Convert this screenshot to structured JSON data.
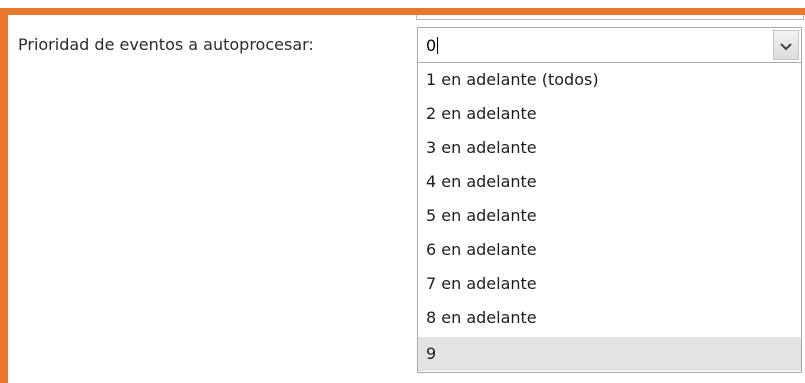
{
  "form": {
    "label": "Prioridad de eventos a autoprocesar:",
    "select": {
      "value": "0",
      "options": [
        "1 en adelante (todos)",
        "2 en adelante",
        "3 en adelante",
        "4 en adelante",
        "5 en adelante",
        "6 en adelante",
        "7 en adelante",
        "8 en adelante",
        "9"
      ],
      "highlighted_option": "9"
    }
  },
  "colors": {
    "frame_border": "#e8782e",
    "highlight": "#e3e3e3"
  }
}
